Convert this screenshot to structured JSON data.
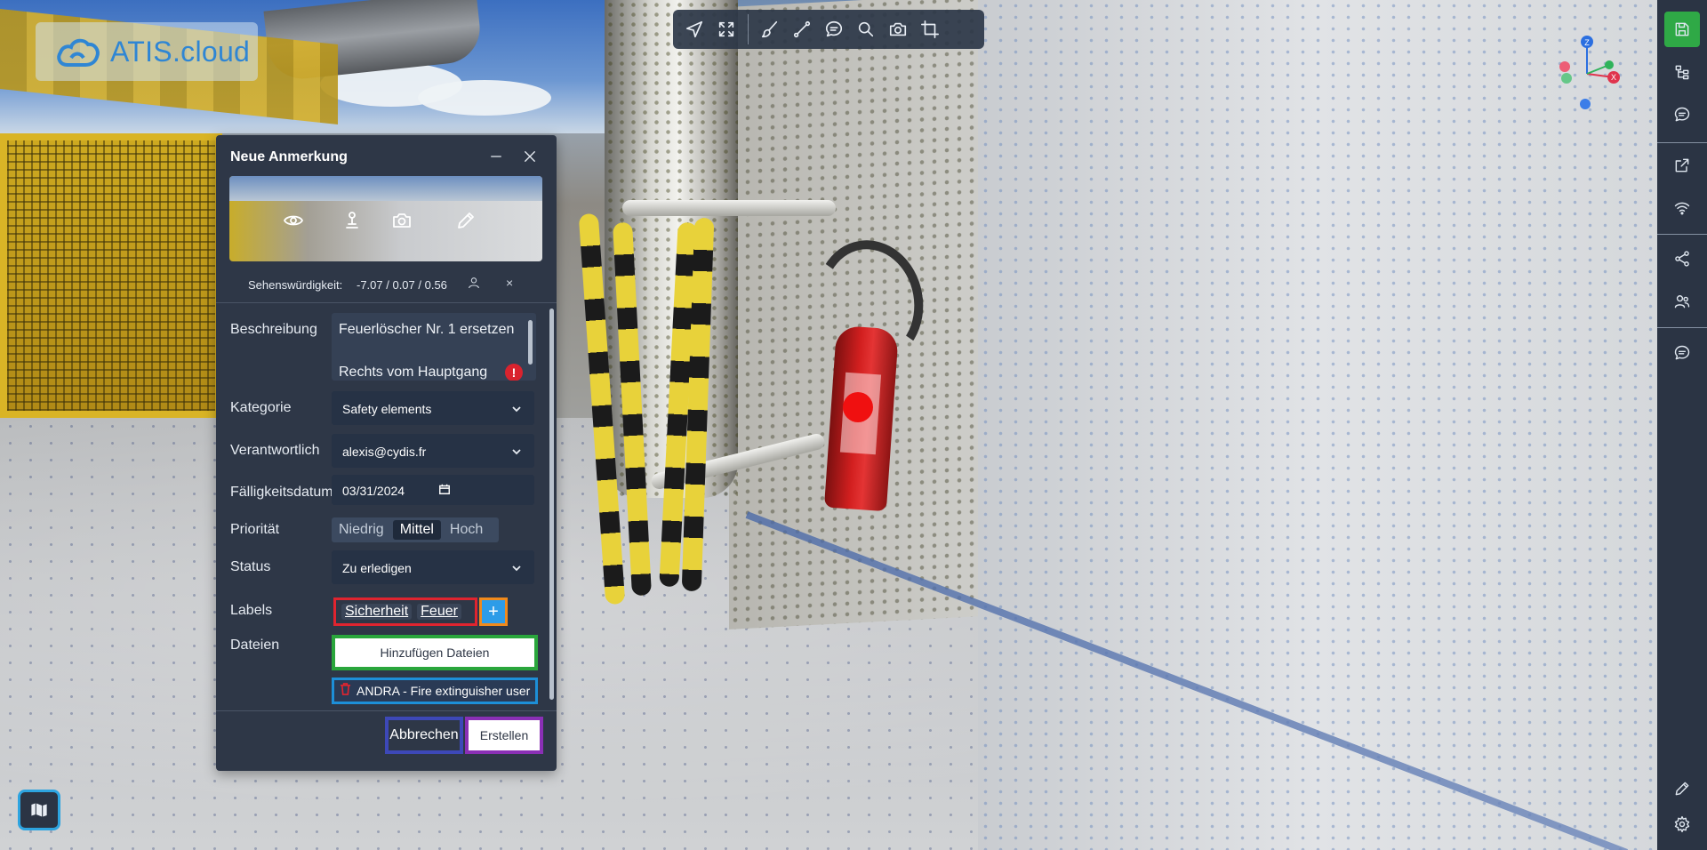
{
  "app": {
    "logo_text": "ATIS.cloud",
    "accent_color": "#2f86d4"
  },
  "toolbar": {
    "items": [
      "navigate-icon",
      "fullscreen-icon",
      "brush-icon",
      "measure-icon",
      "comment-icon",
      "search-icon",
      "camera-icon",
      "crop-icon"
    ]
  },
  "sidebar": {
    "items": [
      "save-icon",
      "tree-icon",
      "comment-icon",
      "external-link-icon",
      "wifi-icon",
      "share-icon",
      "users-icon",
      "annotation-icon",
      "pen-icon",
      "gear-icon"
    ],
    "save_color": "#2fa946"
  },
  "gizmo": {
    "z_label": "Z",
    "x_label": "X"
  },
  "annotation_panel": {
    "title": "Neue Anmerkung",
    "viewpoint": {
      "label": "Sehenswürdigkeit:",
      "value": "-7.07 / 0.07 / 0.56",
      "remove": "×"
    },
    "description": {
      "label": "Beschreibung",
      "lines": [
        "Feuerlöscher Nr. 1 ersetzen",
        "Rechts vom Hauptgang"
      ],
      "warning": "!"
    },
    "category": {
      "label": "Kategorie",
      "value": "Safety elements"
    },
    "responsible": {
      "label": "Verantwortlich",
      "value": "alexis@cydis.fr"
    },
    "due_date": {
      "label": "Fälligkeitsdatum",
      "value": "03/31/2024"
    },
    "priority": {
      "label": "Priorität",
      "options": [
        "Niedrig",
        "Mittel",
        "Hoch"
      ],
      "selected": "Mittel"
    },
    "status": {
      "label": "Status",
      "value": "Zu erledigen"
    },
    "labels": {
      "label": "Labels",
      "tags": [
        "Sicherheit",
        "Feuer"
      ],
      "add": "+"
    },
    "files": {
      "label": "Dateien",
      "add_button": "Hinzufügen Dateien",
      "items": [
        "ANDRA - Fire extinguisher user"
      ]
    },
    "cancel_label": "Abbrechen",
    "create_label": "Erstellen"
  }
}
